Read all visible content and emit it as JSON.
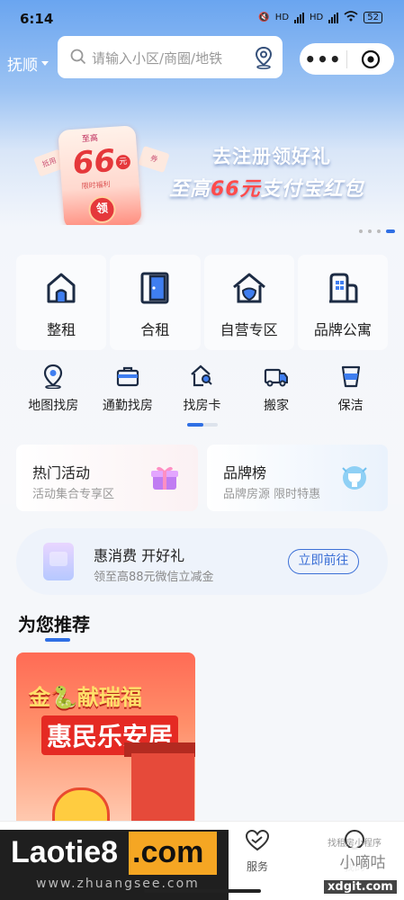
{
  "status_bar": {
    "time": "6:14",
    "network1": "HD",
    "network2": "HD",
    "battery": "52"
  },
  "header": {
    "city": "抚顺",
    "search_placeholder": "请输入小区/商圈/地铁",
    "more_label": "•••"
  },
  "banner": {
    "line1": "去注册领好礼",
    "line2_prefix": "至高",
    "line2_highlight": "66元",
    "line2_suffix": "支付宝红包",
    "packet_tag": "至高",
    "packet_amount": "66",
    "packet_unit": "元",
    "packet_sub": "限时福利",
    "packet_button": "领",
    "ticket_left": "抵用",
    "ticket_right": "券",
    "page_count": 4,
    "active_page": 4
  },
  "categories": [
    {
      "label": "整租",
      "icon": "house-door-icon"
    },
    {
      "label": "合租",
      "icon": "door-icon"
    },
    {
      "label": "自营专区",
      "icon": "home-shield-icon"
    },
    {
      "label": "品牌公寓",
      "icon": "apartment-icon"
    }
  ],
  "quick_links": [
    {
      "label": "地图找房",
      "icon": "map-pin-icon"
    },
    {
      "label": "通勤找房",
      "icon": "briefcase-icon"
    },
    {
      "label": "找房卡",
      "icon": "house-search-icon"
    },
    {
      "label": "搬家",
      "icon": "truck-icon"
    },
    {
      "label": "保洁",
      "icon": "cleaning-cup-icon"
    }
  ],
  "promos": {
    "hot": {
      "title": "热门活动",
      "subtitle": "活动集合专享区"
    },
    "brand": {
      "title": "品牌榜",
      "subtitle": "品牌房源 限时特惠"
    }
  },
  "coupon": {
    "title": "惠消费 开好礼",
    "subtitle": "领至高88元微信立减金",
    "button": "立即前往"
  },
  "recommend": {
    "title": "为您推荐",
    "poster_line1": "金🐍献瑞福",
    "poster_line2": "惠民乐安居"
  },
  "bottom_nav": {
    "service": "服务",
    "partial_label": "我的"
  },
  "watermarks": {
    "left_brand": "Laotie8",
    "left_tld": ".com",
    "left_url": "www.zhuangsee.com",
    "right_top": "找租房小程序",
    "right_brand": "小嘀咕",
    "right_url": "xdgit.com"
  },
  "colors": {
    "accent": "#2f6fe4",
    "banner_red": "#e5383b"
  }
}
